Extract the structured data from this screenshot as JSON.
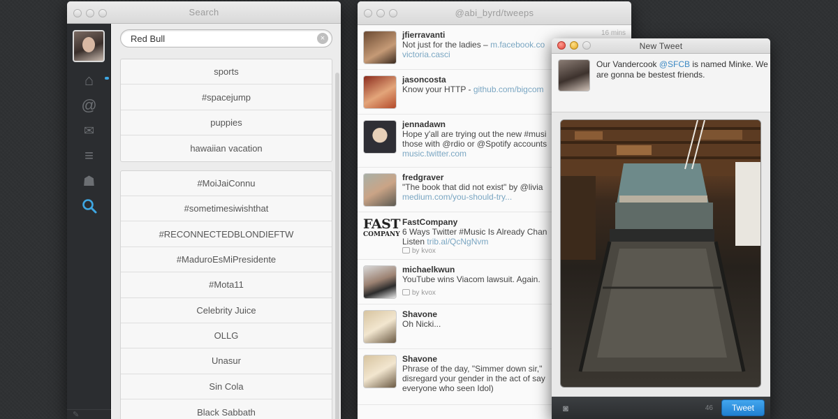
{
  "search_window": {
    "title": "Search",
    "query": "Red Bull",
    "saved_searches": [
      "sports",
      "#spacejump",
      "puppies",
      "hawaiian vacation"
    ],
    "trends": [
      "#MoiJaiConnu",
      "#sometimesiwishthat",
      "#RECONNECTEDBLONDIEFTW",
      "#MaduroEsMiPresidente",
      "#Mota11",
      "Celebrity Juice",
      "OLLG",
      "Unasur",
      "Sin Cola",
      "Black Sabbath"
    ]
  },
  "timeline_window": {
    "title": "@abi_byrd/tweeps",
    "tweets": [
      {
        "user": "jfierravanti",
        "line1": "Not just for the ladies – ",
        "link1": "m.facebook.co",
        "line2": "victoria.casci",
        "time": "16 mins",
        "via": ""
      },
      {
        "user": "jasoncosta",
        "line1": "Know your HTTP - ",
        "link1": "github.com/bigcom",
        "line2": "",
        "time": "",
        "via": ""
      },
      {
        "user": "jennadawn",
        "line1": "Hope y'all are trying out the new #musi",
        "link1": "",
        "line2": "those with @rdio or @Spotify accounts",
        "line3": "music.twitter.com",
        "time": "",
        "via": ""
      },
      {
        "user": "fredgraver",
        "line1": "\"The book that did not exist\" by @livia",
        "link1": "",
        "line2": "medium.com/you-should-try...",
        "time": "",
        "via": ""
      },
      {
        "user": "FastCompany",
        "line1": "6 Ways Twitter #Music Is Already Chan",
        "link1": "",
        "line2": "Listen ",
        "line2link": "trib.al/QcNgNvm",
        "time": "",
        "via": "by kvox"
      },
      {
        "user": "michaelkwun",
        "line1": "YouTube wins Viacom lawsuit. Again.",
        "link1": "",
        "line2": "",
        "time": "",
        "via": "by kvox"
      },
      {
        "user": "Shavone",
        "line1": "Oh Nicki...",
        "link1": "",
        "line2": "",
        "time": "",
        "via": ""
      },
      {
        "user": "Shavone",
        "line1": "Phrase of the day, \"Simmer down sir,\"",
        "link1": "",
        "line2": "disregard your gender in the act of say",
        "line3": "everyone who seen Idol)",
        "time": "",
        "via": ""
      }
    ],
    "fastcompany_logo": [
      "FAST",
      "COMPANY"
    ]
  },
  "compose_window": {
    "title": "New Tweet",
    "text_before": "Our Vandercook ",
    "mention": "@SFCB",
    "text_after": " is named Minke. We are gonna be bestest friends.",
    "char_count": "46",
    "tweet_label": "Tweet"
  },
  "icons": {
    "home": "⌂",
    "mention": "@",
    "messages": "✉",
    "lists": "≡",
    "profile": "☗",
    "search": "⚲",
    "camera": "◙",
    "clear": "×"
  },
  "colors": {
    "accent": "#3ea7e3",
    "link": "#7aa6c2",
    "tweet_button": "#2a8bd9"
  }
}
